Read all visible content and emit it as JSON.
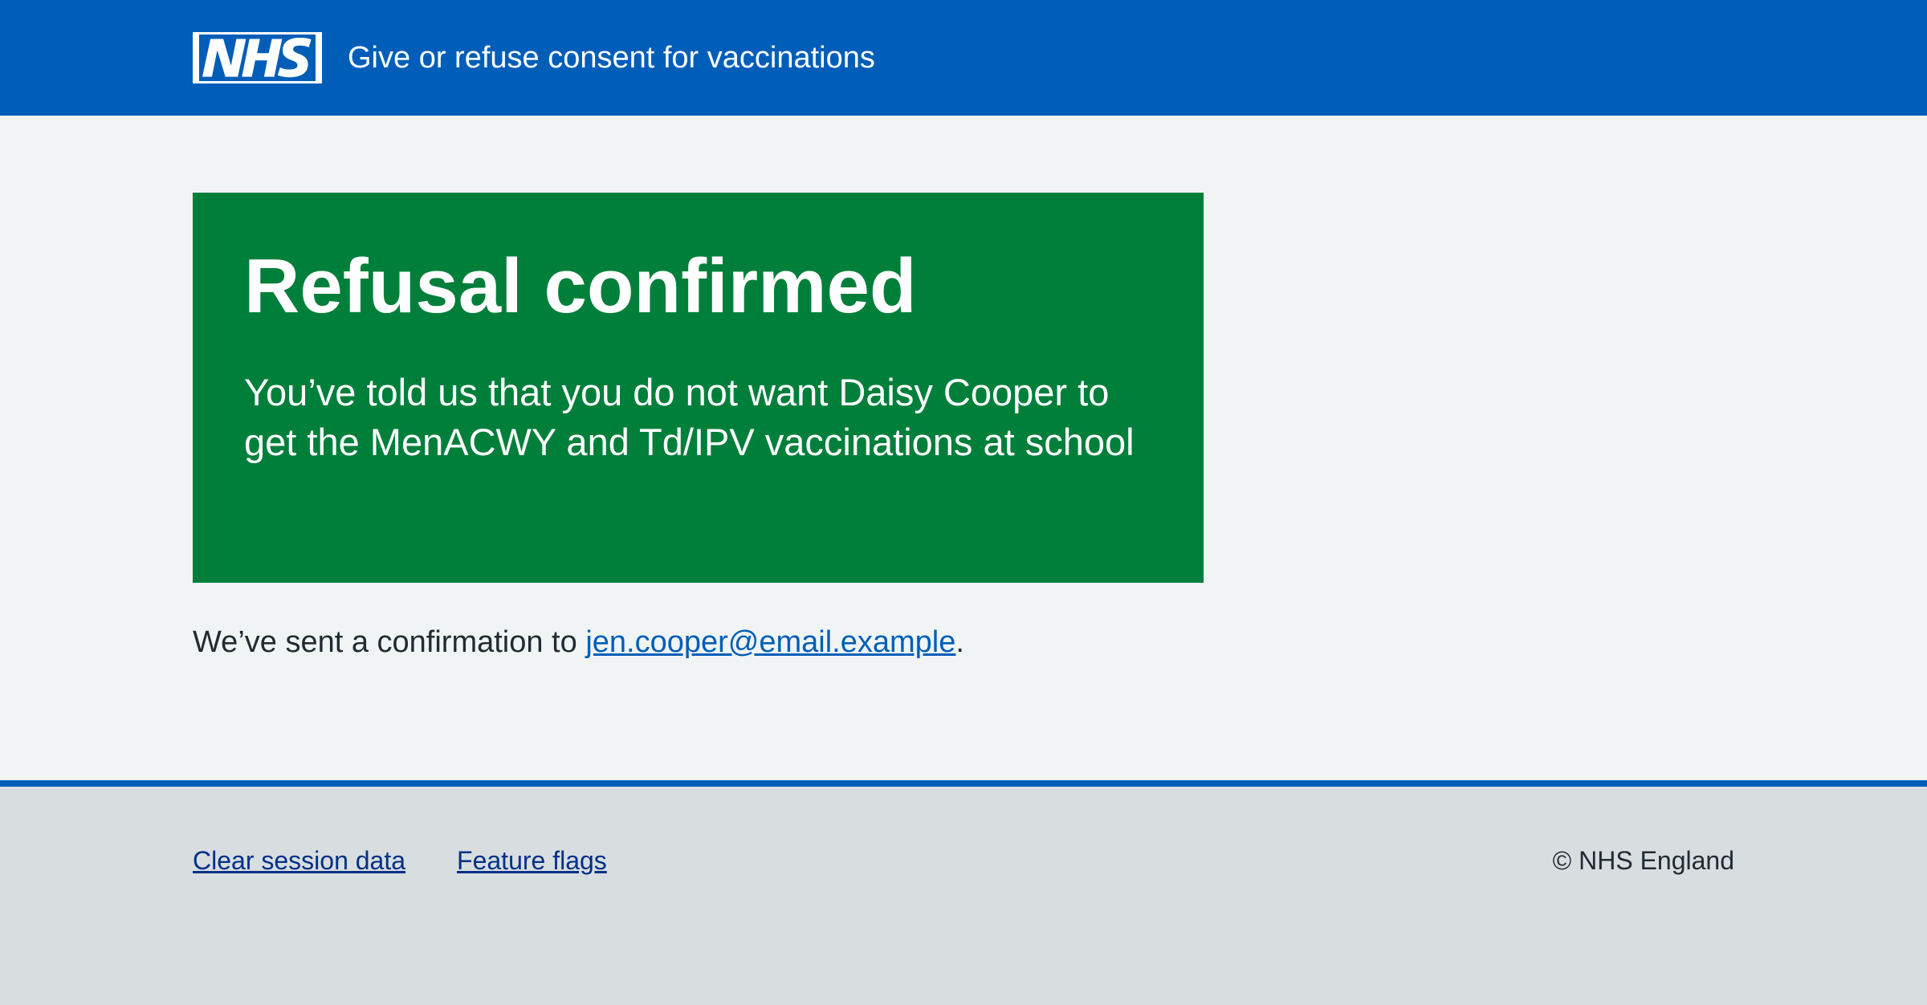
{
  "header": {
    "logo_text": "NHS",
    "service_name": "Give or refuse consent for vaccinations",
    "colors": {
      "background": "#005eb8",
      "text": "#ffffff"
    }
  },
  "panel": {
    "title": "Refusal confirmed",
    "body": "You’ve told us that you do not want Daisy Cooper to get the MenACWY and Td/IPV vaccinations at school",
    "color": "#007f3b"
  },
  "confirmation": {
    "prefix": "We’ve sent a confirmation to ",
    "email": "jen.cooper@email.example",
    "suffix": "."
  },
  "footer": {
    "links": [
      "Clear session data",
      "Feature flags"
    ],
    "copyright": "© NHS England",
    "border_color": "#005eb8"
  }
}
